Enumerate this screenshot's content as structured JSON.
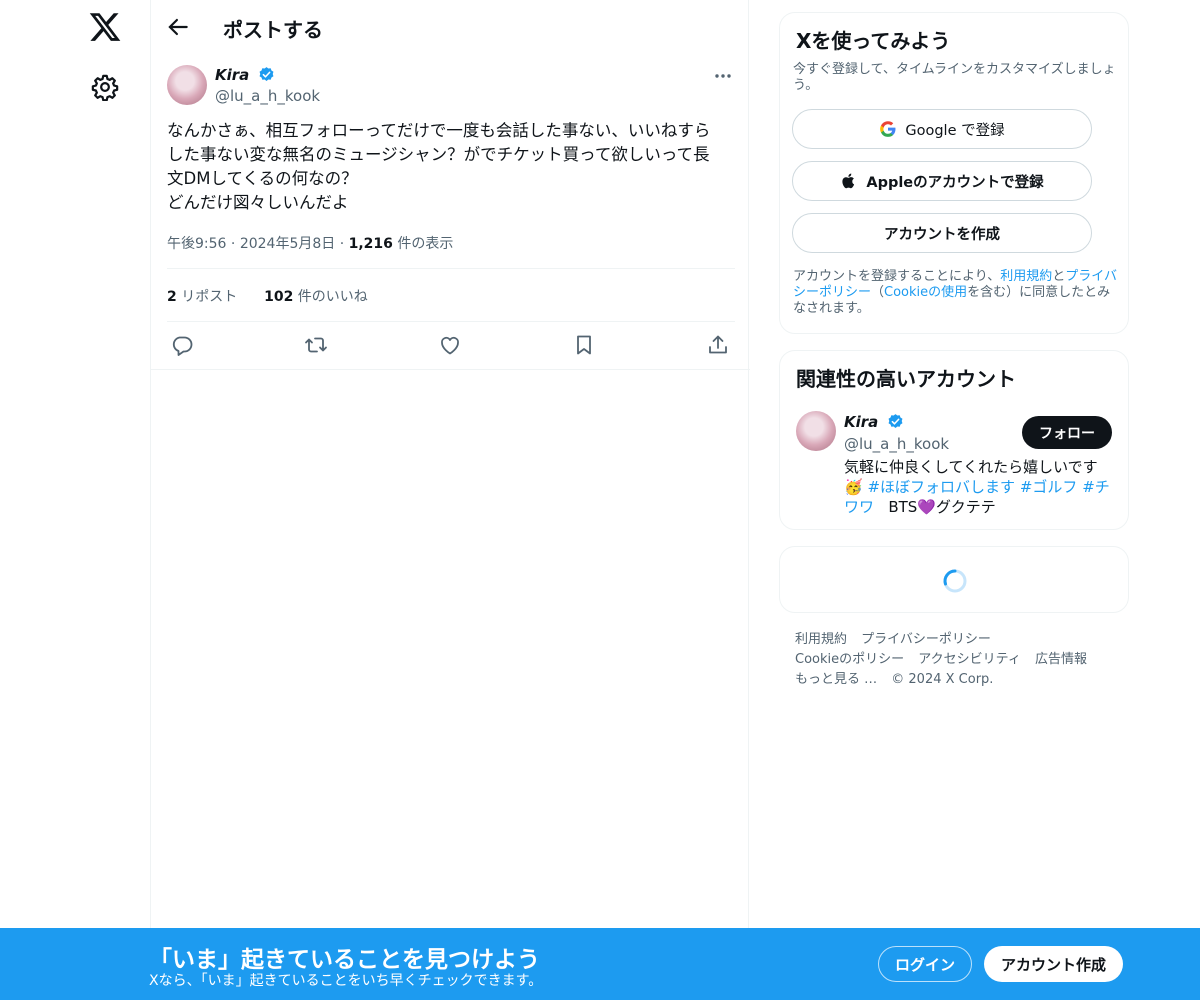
{
  "nav": {
    "logo_icon": "x-logo-icon",
    "settings_icon": "gear-icon"
  },
  "header": {
    "title": "ポストする",
    "back_icon": "arrow-left-icon"
  },
  "post": {
    "author_name": "Kira",
    "author_handle": "@lu_a_h_kook",
    "text_lines": [
      "なんかさぁ、相互フォローってだけで一度も会話した事ない、いいねすら",
      "した事ない変な無名のミュージシャン？がでチケット買って欲しいって長",
      "文DMしてくるの何なの？",
      "どんだけ図々しいんだよ"
    ],
    "time": "午後9:56",
    "date": "2024年5月8日",
    "views_count": "1,216",
    "views_label": "件の表示",
    "reposts_count": "2",
    "reposts_label": "リポスト",
    "likes_count": "102",
    "likes_label": "件のいいね"
  },
  "signup": {
    "title": "Xを使ってみよう",
    "subtitle": "今すぐ登録して、タイムラインをカスタマイズしましょう。",
    "google_label": "Google で登録",
    "apple_label": "Appleのアカウントで登録",
    "create_label": "アカウントを作成",
    "legal_1": "アカウントを登録することにより、",
    "legal_terms": "利用規約",
    "legal_2": "と",
    "legal_privacy": "プライバシーポリシー",
    "legal_3": "（",
    "legal_cookie": "Cookieの使用",
    "legal_4": "を含む）に同意したとみなされます。"
  },
  "related": {
    "title": "関連性の高いアカウント",
    "name": "Kira",
    "handle": "@lu_a_h_kook",
    "follow_label": "フォロー",
    "bio_1": "気軽に仲良くしてくれたら嬉しいです",
    "bio_emoji": "🥳",
    "bio_tag1": "#ほぼフォロバします",
    "bio_tag2": "#ゴルフ",
    "bio_tag3": "#チワワ",
    "bio_2": "BTS",
    "bio_heart": "💜",
    "bio_3": "グクテテ"
  },
  "footer": {
    "terms": "利用規約",
    "privacy": "プライバシーポリシー",
    "cookie": "Cookieのポリシー",
    "accessibility": "アクセシビリティ",
    "ads": "広告情報",
    "more": "もっと見る …",
    "copyright": "© 2024 X Corp."
  },
  "banner": {
    "title": "「いま」起きていることを見つけよう",
    "subtitle": "Xなら、「いま」起きていることをいち早くチェックできます。",
    "login_label": "ログイン",
    "create_label": "アカウント作成"
  },
  "colors": {
    "accent": "#1d9bf0",
    "text": "#0f1419",
    "muted": "#536471",
    "border": "#eff3f4"
  }
}
